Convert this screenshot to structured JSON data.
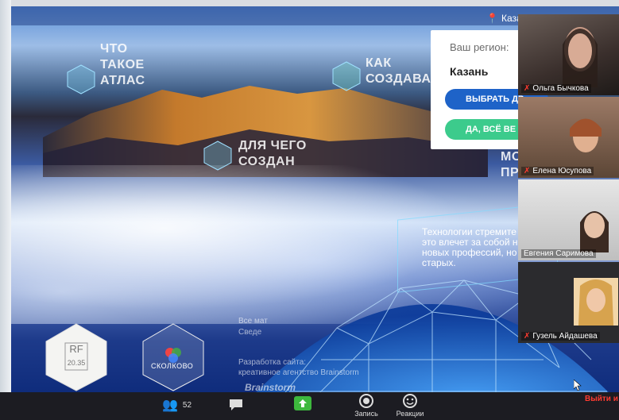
{
  "site": {
    "location": "Казань",
    "nav": [
      {
        "label": "ЧТО ТАКОЕ АТЛАС"
      },
      {
        "label": "КАК СОЗДАВАЛСЯ"
      },
      {
        "label": "ДЛЯ ЧЕГО СОЗДАН"
      },
      {
        "label": "МОЖ ПРИМ"
      }
    ],
    "region_card": {
      "label": "Ваш регион:",
      "city": "Казань",
      "choose_button": "ВЫБРАТЬ ДР",
      "confirm_button": "ДА, ВСЁ ВЕ"
    },
    "tech_text": "Технологии стремите это влечет за собой н новых профессий, но старых.",
    "footer": {
      "rights_line1": "Все мат",
      "rights_line2": "Сведе",
      "dev_label": "Разработка сайта:",
      "dev_agency": "креативное агентство Brainstorm",
      "dev_logo": "Brainstorm"
    },
    "badges": [
      {
        "title": "RF",
        "sub": "20.35"
      },
      {
        "title": "СКОЛКОВО"
      }
    ]
  },
  "participants": [
    {
      "name": "Ольга Бычкова",
      "muted": true
    },
    {
      "name": "Елена Юсупова",
      "muted": true
    },
    {
      "name": "Евгения Саримова",
      "muted": false
    },
    {
      "name": "Гузель Айдашева",
      "muted": true
    }
  ],
  "toolbar": {
    "participants_count": "52",
    "record_label": "Запись",
    "reactions_label": "Реакции",
    "exit_label": "Выйти и"
  },
  "colors": {
    "accent_blue": "#1e63c8",
    "accent_green": "#3ccb8c",
    "exit_red": "#ff3b30"
  }
}
